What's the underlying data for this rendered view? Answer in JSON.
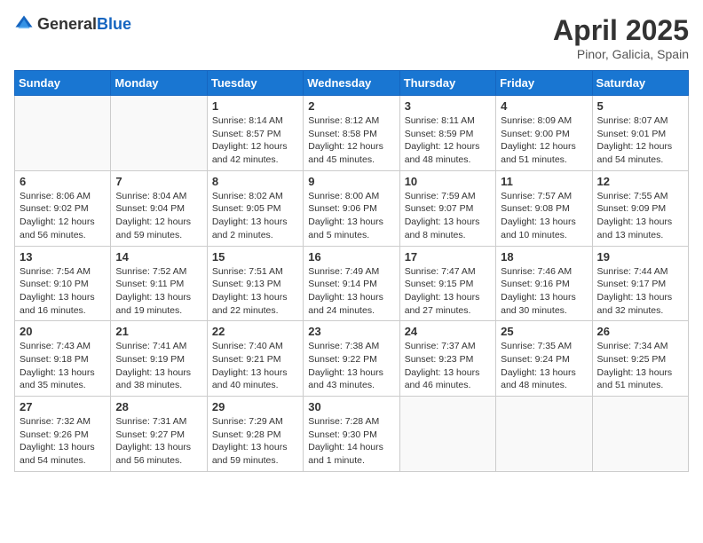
{
  "header": {
    "logo_general": "General",
    "logo_blue": "Blue",
    "title": "April 2025",
    "subtitle": "Pinor, Galicia, Spain"
  },
  "weekdays": [
    "Sunday",
    "Monday",
    "Tuesday",
    "Wednesday",
    "Thursday",
    "Friday",
    "Saturday"
  ],
  "weeks": [
    [
      {
        "day": "",
        "info": ""
      },
      {
        "day": "",
        "info": ""
      },
      {
        "day": "1",
        "info": "Sunrise: 8:14 AM\nSunset: 8:57 PM\nDaylight: 12 hours and 42 minutes."
      },
      {
        "day": "2",
        "info": "Sunrise: 8:12 AM\nSunset: 8:58 PM\nDaylight: 12 hours and 45 minutes."
      },
      {
        "day": "3",
        "info": "Sunrise: 8:11 AM\nSunset: 8:59 PM\nDaylight: 12 hours and 48 minutes."
      },
      {
        "day": "4",
        "info": "Sunrise: 8:09 AM\nSunset: 9:00 PM\nDaylight: 12 hours and 51 minutes."
      },
      {
        "day": "5",
        "info": "Sunrise: 8:07 AM\nSunset: 9:01 PM\nDaylight: 12 hours and 54 minutes."
      }
    ],
    [
      {
        "day": "6",
        "info": "Sunrise: 8:06 AM\nSunset: 9:02 PM\nDaylight: 12 hours and 56 minutes."
      },
      {
        "day": "7",
        "info": "Sunrise: 8:04 AM\nSunset: 9:04 PM\nDaylight: 12 hours and 59 minutes."
      },
      {
        "day": "8",
        "info": "Sunrise: 8:02 AM\nSunset: 9:05 PM\nDaylight: 13 hours and 2 minutes."
      },
      {
        "day": "9",
        "info": "Sunrise: 8:00 AM\nSunset: 9:06 PM\nDaylight: 13 hours and 5 minutes."
      },
      {
        "day": "10",
        "info": "Sunrise: 7:59 AM\nSunset: 9:07 PM\nDaylight: 13 hours and 8 minutes."
      },
      {
        "day": "11",
        "info": "Sunrise: 7:57 AM\nSunset: 9:08 PM\nDaylight: 13 hours and 10 minutes."
      },
      {
        "day": "12",
        "info": "Sunrise: 7:55 AM\nSunset: 9:09 PM\nDaylight: 13 hours and 13 minutes."
      }
    ],
    [
      {
        "day": "13",
        "info": "Sunrise: 7:54 AM\nSunset: 9:10 PM\nDaylight: 13 hours and 16 minutes."
      },
      {
        "day": "14",
        "info": "Sunrise: 7:52 AM\nSunset: 9:11 PM\nDaylight: 13 hours and 19 minutes."
      },
      {
        "day": "15",
        "info": "Sunrise: 7:51 AM\nSunset: 9:13 PM\nDaylight: 13 hours and 22 minutes."
      },
      {
        "day": "16",
        "info": "Sunrise: 7:49 AM\nSunset: 9:14 PM\nDaylight: 13 hours and 24 minutes."
      },
      {
        "day": "17",
        "info": "Sunrise: 7:47 AM\nSunset: 9:15 PM\nDaylight: 13 hours and 27 minutes."
      },
      {
        "day": "18",
        "info": "Sunrise: 7:46 AM\nSunset: 9:16 PM\nDaylight: 13 hours and 30 minutes."
      },
      {
        "day": "19",
        "info": "Sunrise: 7:44 AM\nSunset: 9:17 PM\nDaylight: 13 hours and 32 minutes."
      }
    ],
    [
      {
        "day": "20",
        "info": "Sunrise: 7:43 AM\nSunset: 9:18 PM\nDaylight: 13 hours and 35 minutes."
      },
      {
        "day": "21",
        "info": "Sunrise: 7:41 AM\nSunset: 9:19 PM\nDaylight: 13 hours and 38 minutes."
      },
      {
        "day": "22",
        "info": "Sunrise: 7:40 AM\nSunset: 9:21 PM\nDaylight: 13 hours and 40 minutes."
      },
      {
        "day": "23",
        "info": "Sunrise: 7:38 AM\nSunset: 9:22 PM\nDaylight: 13 hours and 43 minutes."
      },
      {
        "day": "24",
        "info": "Sunrise: 7:37 AM\nSunset: 9:23 PM\nDaylight: 13 hours and 46 minutes."
      },
      {
        "day": "25",
        "info": "Sunrise: 7:35 AM\nSunset: 9:24 PM\nDaylight: 13 hours and 48 minutes."
      },
      {
        "day": "26",
        "info": "Sunrise: 7:34 AM\nSunset: 9:25 PM\nDaylight: 13 hours and 51 minutes."
      }
    ],
    [
      {
        "day": "27",
        "info": "Sunrise: 7:32 AM\nSunset: 9:26 PM\nDaylight: 13 hours and 54 minutes."
      },
      {
        "day": "28",
        "info": "Sunrise: 7:31 AM\nSunset: 9:27 PM\nDaylight: 13 hours and 56 minutes."
      },
      {
        "day": "29",
        "info": "Sunrise: 7:29 AM\nSunset: 9:28 PM\nDaylight: 13 hours and 59 minutes."
      },
      {
        "day": "30",
        "info": "Sunrise: 7:28 AM\nSunset: 9:30 PM\nDaylight: 14 hours and 1 minute."
      },
      {
        "day": "",
        "info": ""
      },
      {
        "day": "",
        "info": ""
      },
      {
        "day": "",
        "info": ""
      }
    ]
  ]
}
